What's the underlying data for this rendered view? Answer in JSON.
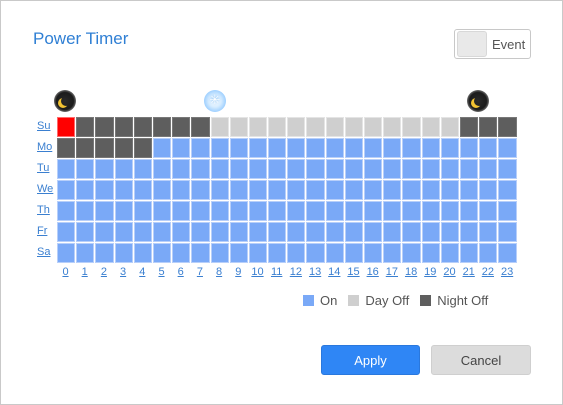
{
  "dialog": {
    "title": "Power Timer",
    "event_label": "Event"
  },
  "icons": [
    "moon-icon",
    "sun-icon",
    "moon-icon"
  ],
  "days": [
    "Su",
    "Mo",
    "Tu",
    "We",
    "Th",
    "Fr",
    "Sa"
  ],
  "hours": [
    "0",
    "1",
    "2",
    "3",
    "4",
    "5",
    "6",
    "7",
    "8",
    "9",
    "10",
    "11",
    "12",
    "13",
    "14",
    "15",
    "16",
    "17",
    "18",
    "19",
    "20",
    "21",
    "22",
    "23"
  ],
  "schedule": {
    "Su": [
      "selected",
      "night_off",
      "night_off",
      "night_off",
      "night_off",
      "night_off",
      "night_off",
      "night_off",
      "day_off",
      "day_off",
      "day_off",
      "day_off",
      "day_off",
      "day_off",
      "day_off",
      "day_off",
      "day_off",
      "day_off",
      "day_off",
      "day_off",
      "day_off",
      "night_off",
      "night_off",
      "night_off"
    ],
    "Mo": [
      "night_off",
      "night_off",
      "night_off",
      "night_off",
      "night_off",
      "on",
      "on",
      "on",
      "on",
      "on",
      "on",
      "on",
      "on",
      "on",
      "on",
      "on",
      "on",
      "on",
      "on",
      "on",
      "on",
      "on",
      "on",
      "on"
    ],
    "Tu": [
      "on",
      "on",
      "on",
      "on",
      "on",
      "on",
      "on",
      "on",
      "on",
      "on",
      "on",
      "on",
      "on",
      "on",
      "on",
      "on",
      "on",
      "on",
      "on",
      "on",
      "on",
      "on",
      "on",
      "on"
    ],
    "We": [
      "on",
      "on",
      "on",
      "on",
      "on",
      "on",
      "on",
      "on",
      "on",
      "on",
      "on",
      "on",
      "on",
      "on",
      "on",
      "on",
      "on",
      "on",
      "on",
      "on",
      "on",
      "on",
      "on",
      "on"
    ],
    "Th": [
      "on",
      "on",
      "on",
      "on",
      "on",
      "on",
      "on",
      "on",
      "on",
      "on",
      "on",
      "on",
      "on",
      "on",
      "on",
      "on",
      "on",
      "on",
      "on",
      "on",
      "on",
      "on",
      "on",
      "on"
    ],
    "Fr": [
      "on",
      "on",
      "on",
      "on",
      "on",
      "on",
      "on",
      "on",
      "on",
      "on",
      "on",
      "on",
      "on",
      "on",
      "on",
      "on",
      "on",
      "on",
      "on",
      "on",
      "on",
      "on",
      "on",
      "on"
    ],
    "Sa": [
      "on",
      "on",
      "on",
      "on",
      "on",
      "on",
      "on",
      "on",
      "on",
      "on",
      "on",
      "on",
      "on",
      "on",
      "on",
      "on",
      "on",
      "on",
      "on",
      "on",
      "on",
      "on",
      "on",
      "on"
    ]
  },
  "legend": {
    "on": "On",
    "day_off": "Day Off",
    "night_off": "Night Off"
  },
  "colors": {
    "on": "#7aa9f7",
    "day_off": "#cfcfcf",
    "night_off": "#5e5e5e",
    "selected": "#ff0000",
    "accent": "#2f86f5"
  },
  "buttons": {
    "apply": "Apply",
    "cancel": "Cancel"
  }
}
